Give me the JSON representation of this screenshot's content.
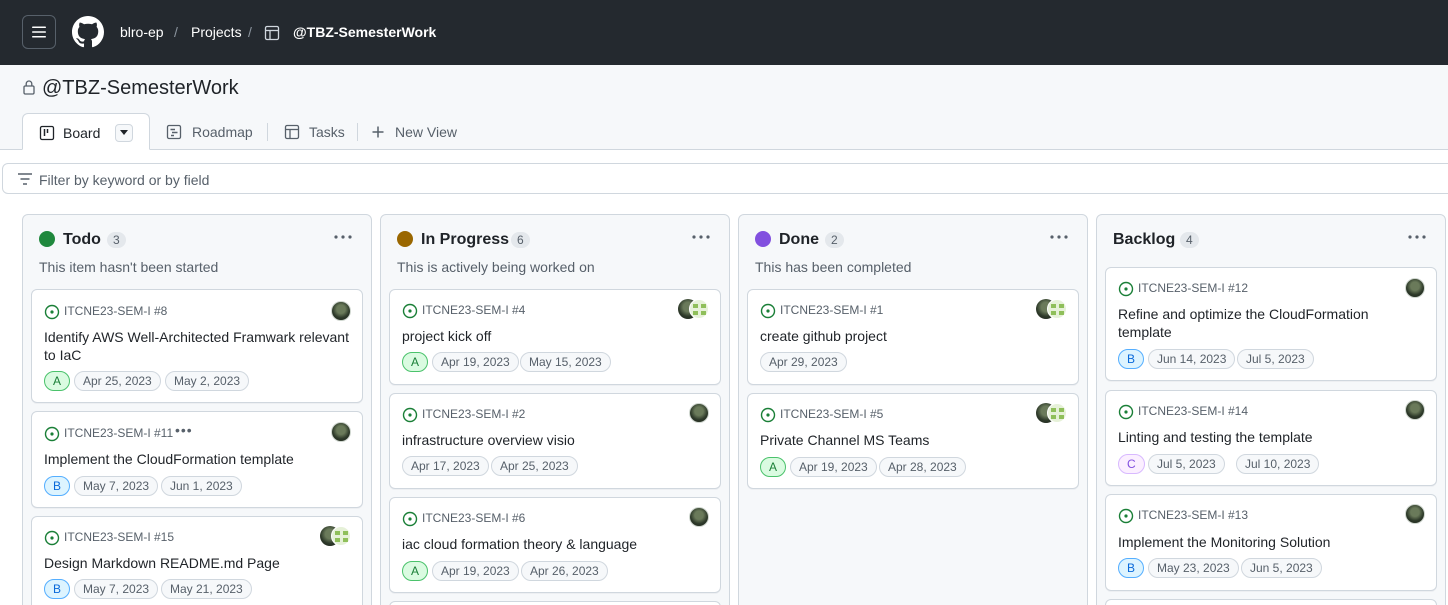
{
  "header": {
    "breadcrumbs": [
      {
        "label": "blro-ep"
      },
      {
        "label": "Projects"
      },
      {
        "label": "@TBZ-SemesterWork"
      }
    ]
  },
  "project": {
    "title": "@TBZ-SemesterWork"
  },
  "views": {
    "tabs": [
      {
        "label": "Board",
        "icon": "board-icon",
        "active": true
      },
      {
        "label": "Roadmap",
        "icon": "roadmap-icon"
      },
      {
        "label": "Tasks",
        "icon": "table-icon"
      },
      {
        "label": "New View",
        "icon": "plus-icon"
      }
    ]
  },
  "filter": {
    "placeholder": "Filter by keyword or by field"
  },
  "colors": {
    "todo": "#1f883d",
    "in_progress": "#9a6700",
    "done": "#8250df",
    "open_issue": "#1a7f37"
  },
  "columns": [
    {
      "title": "Todo",
      "count": "3",
      "description": "This item hasn't been started",
      "cards": [
        {
          "ref": "ITCNE23-SEM-I #8",
          "title": "Identify AWS Well-Architected Framwark relevant to IaC",
          "size": "A",
          "start": "Apr 25, 2023",
          "end": "May 2, 2023"
        },
        {
          "ref": "ITCNE23-SEM-I #11",
          "more": "•••",
          "title": "Implement the CloudFormation template",
          "size": "B",
          "start": "May 7, 2023",
          "end": "Jun 1, 2023"
        },
        {
          "ref": "ITCNE23-SEM-I #15",
          "title": "Design Markdown README.md Page",
          "size": "B",
          "start": "May 7, 2023",
          "end": "May 21, 2023"
        }
      ]
    },
    {
      "title": "In Progress",
      "count": "6",
      "description": "This is actively being worked on",
      "cards": [
        {
          "ref": "ITCNE23-SEM-I #4",
          "title": "project kick off",
          "size": "A",
          "start": "Apr 19, 2023",
          "end": "May 15, 2023"
        },
        {
          "ref": "ITCNE23-SEM-I #2",
          "title": "infrastructure overview visio",
          "start": "Apr 17, 2023",
          "end": "Apr 25, 2023"
        },
        {
          "ref": "ITCNE23-SEM-I #6",
          "title": "iac cloud formation theory & language",
          "size": "A",
          "start": "Apr 19, 2023",
          "end": "Apr 26, 2023"
        }
      ]
    },
    {
      "title": "Done",
      "count": "2",
      "description": "This has been completed",
      "cards": [
        {
          "ref": "ITCNE23-SEM-I #1",
          "title": "create github project",
          "start": "Apr 29, 2023"
        },
        {
          "ref": "ITCNE23-SEM-I #5",
          "title": "Private Channel MS Teams",
          "size": "A",
          "start": "Apr 19, 2023",
          "end": "Apr 28, 2023"
        }
      ]
    },
    {
      "title": "Backlog",
      "count": "4",
      "cards": [
        {
          "ref": "ITCNE23-SEM-I #12",
          "title": "Refine and optimize the CloudFormation template",
          "size": "B",
          "start": "Jun 14, 2023",
          "end": "Jul 5, 2023"
        },
        {
          "ref": "ITCNE23-SEM-I #14",
          "title": "Linting and testing the template",
          "size": "C",
          "start": "Jul 5, 2023",
          "end": "Jul 10, 2023"
        },
        {
          "ref": "ITCNE23-SEM-I #13",
          "title": "Implement the Monitoring Solution",
          "size": "B",
          "start": "May 23, 2023",
          "end": "Jun 5, 2023"
        }
      ]
    }
  ]
}
